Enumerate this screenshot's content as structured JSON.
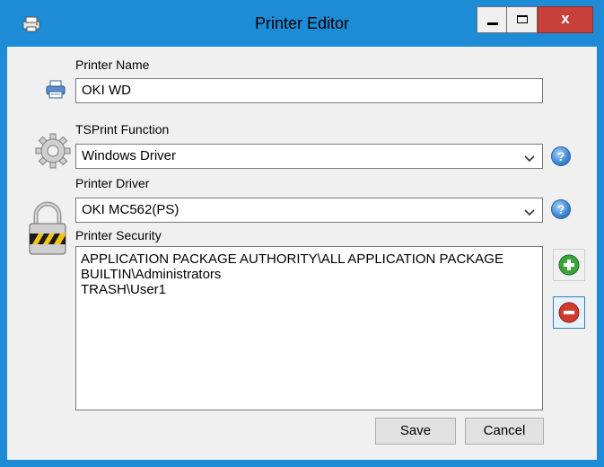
{
  "window": {
    "title": "Printer Editor",
    "close_glyph": "x",
    "icons": {
      "app": "printer-app-icon",
      "minimize": "minimize-icon",
      "maximize": "maximize-icon",
      "close": "close-icon"
    }
  },
  "form": {
    "printer_name": {
      "label": "Printer Name",
      "value": "OKI WD",
      "icon": "printer-icon"
    },
    "tsprint_function": {
      "label": "TSPrint Function",
      "value": "Windows Driver",
      "icon": "gear-icon",
      "help_glyph": "?"
    },
    "printer_driver": {
      "label": "Printer Driver",
      "value": "OKI MC562(PS)",
      "help_glyph": "?"
    },
    "printer_security": {
      "label": "Printer Security",
      "icon": "padlock-icon",
      "items": [
        "APPLICATION PACKAGE AUTHORITY\\ALL APPLICATION PACKAGE",
        "BUILTIN\\Administrators",
        "TRASH\\User1"
      ]
    }
  },
  "buttons": {
    "save": "Save",
    "cancel": "Cancel",
    "add_icon": "plus-icon",
    "remove_icon": "minus-icon"
  },
  "colors": {
    "titlebar": "#1e8bd6",
    "close_button": "#c7403a",
    "add": "#3aa63a",
    "remove": "#d23a2c",
    "help": "#3a86d4"
  }
}
